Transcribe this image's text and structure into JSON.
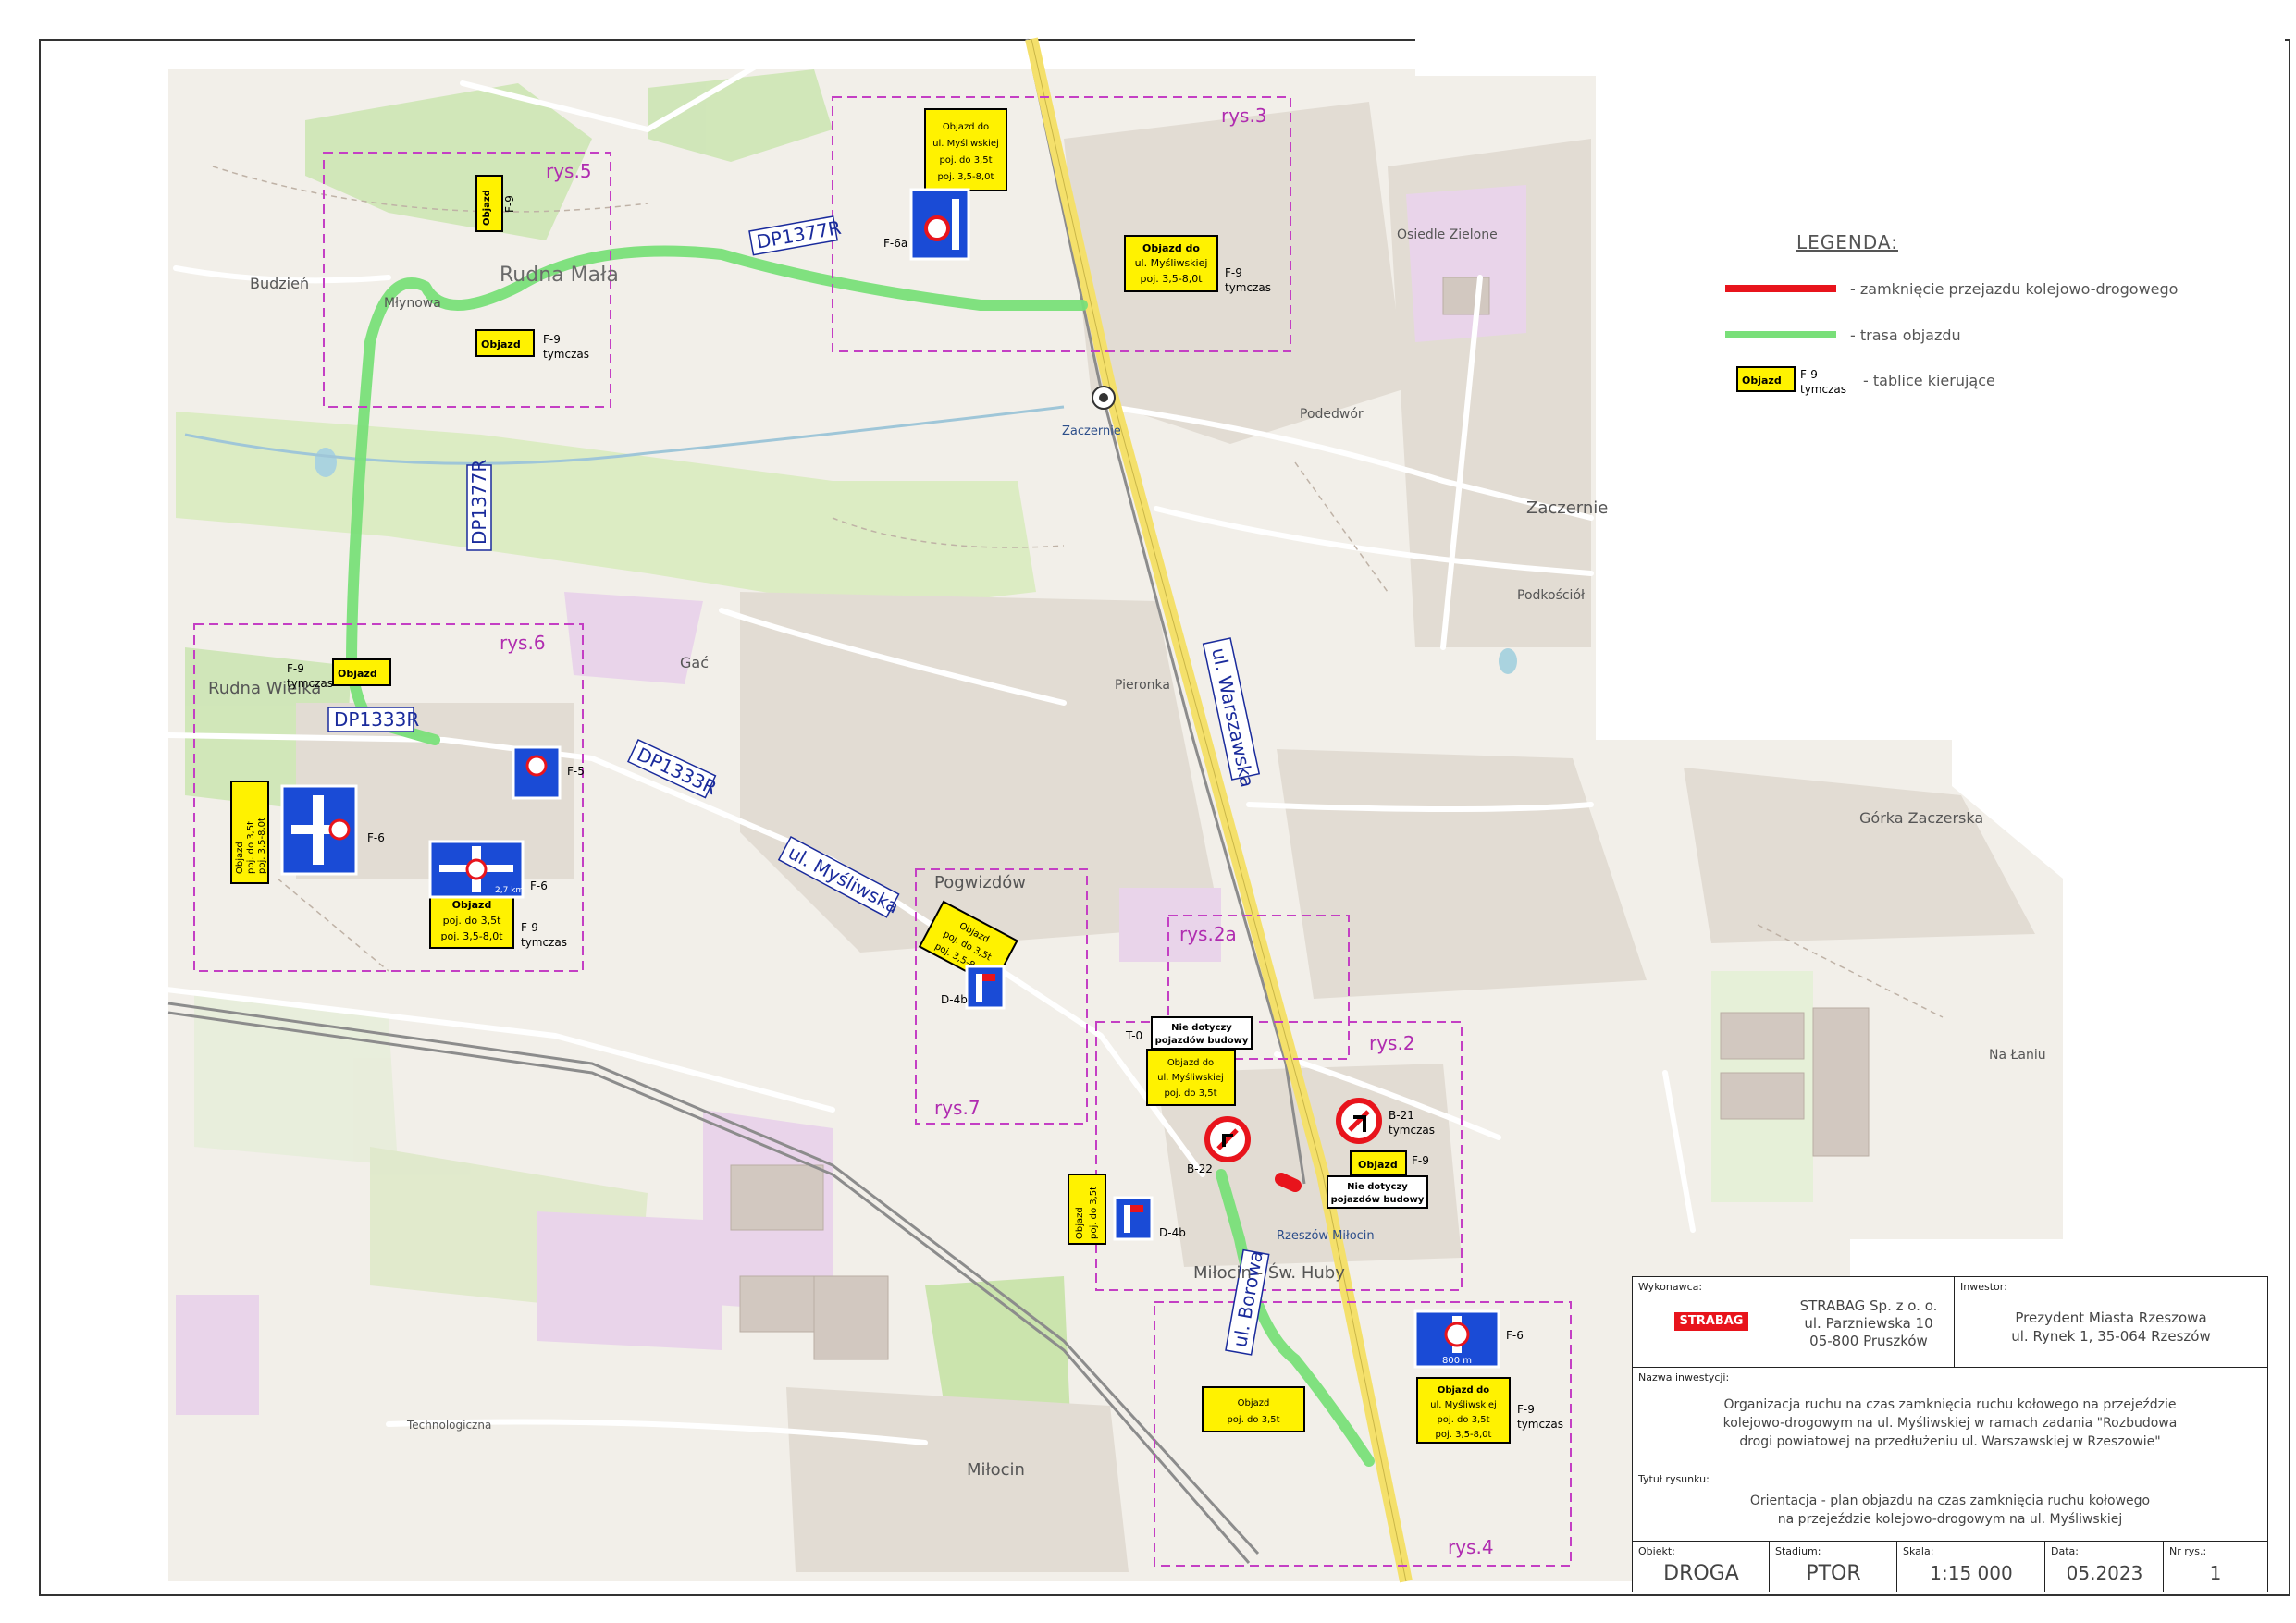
{
  "legend": {
    "title": "LEGENDA:",
    "closure": "- zamknięcie przejazdu kolejowo-drogowego",
    "detour": "- trasa objazdu",
    "sign_main": "Objazd",
    "sign_code": "F-9",
    "sign_temp": "tymczas",
    "signs": "- tablice kierujące",
    "colors": {
      "closure": "#e8141c",
      "detour": "#7fe07f",
      "sign": "#fff200",
      "frame": "#c43fc4"
    }
  },
  "frames": [
    {
      "label": "rys.5"
    },
    {
      "label": "rys.3"
    },
    {
      "label": "rys.6"
    },
    {
      "label": "rys.7"
    },
    {
      "label": "rys.2a"
    },
    {
      "label": "rys.2"
    },
    {
      "label": "rys.4"
    }
  ],
  "roads": {
    "dp1377r_a": "DP1377R",
    "dp1377r_b": "DP1377R",
    "dp1333r_a": "DP1333R",
    "dp1333r_b": "DP1333R",
    "mysliwska": "ul. Myśliwska",
    "warszawska": "ul. Warszawska",
    "borowa": "ul. Borowa"
  },
  "places": {
    "budzien": "Budzień",
    "rudna_mala": "Rudna Mała",
    "mlynowa": "Młynowa",
    "zaczernie": "Zaczernie",
    "zaczernie2": "Zaczernie",
    "podedwor": "Podedwór",
    "osiedle": "Osiedle Zielone",
    "podkosciol": "Podkościół",
    "rudna_wielka": "Rudna Wielka",
    "gac": "Gać",
    "pogwizdow": "Pogwizdów",
    "pieronka": "Pieronka",
    "gorka": "Górka Zaczerska",
    "na_laniu": "Na Łaniu",
    "rzeszow_milocin": "Rzeszów Miłocin",
    "milocin_sw": "Miłocin - Św. Huby",
    "milocin": "Miłocin",
    "technologiczna": "Technologiczna"
  },
  "signs": {
    "objazd": "Objazd",
    "f9": "F-9",
    "f6": "F-6",
    "f6a": "F-6a",
    "f5": "F-5",
    "d4b": "D-4b",
    "b21": "B-21",
    "b22": "B-22",
    "t0": "T-0",
    "tymczas": "tymczas",
    "objazd_do": "Objazd do",
    "ul_mysliwskiej": "ul. Myśliwskiej",
    "poj_35": "poj. do 3,5t",
    "poj_358": "poj. 3,5-8,0t",
    "nie_dotyczy": "Nie dotyczy",
    "pojazdow_budowy": "pojazdów budowy",
    "dist_27": "2,7 km",
    "dist_800": "800 m"
  },
  "title_block": {
    "contractor_label": "Wykonawca:",
    "contractor_logo": "STRABAG",
    "contractor_lines": [
      "STRABAG Sp. z o. o.",
      "ul. Parzniewska 10",
      "05-800 Pruszków"
    ],
    "investor_label": "Inwestor:",
    "investor_lines": [
      "Prezydent Miasta Rzeszowa",
      "ul. Rynek 1, 35-064 Rzeszów"
    ],
    "investment_label": "Nazwa inwestycji:",
    "investment_lines": [
      "Organizacja ruchu na czas zamknięcia ruchu kołowego na przejeździe",
      "kolejowo-drogowym na ul. Myśliwskiej w ramach zadania \"Rozbudowa",
      "drogi powiatowej na przedłużeniu ul. Warszawskiej w Rzeszowie\""
    ],
    "drawing_label": "Tytuł rysunku:",
    "drawing_lines": [
      "Orientacja - plan objazdu na czas zamknięcia ruchu kołowego",
      "na przejeździe kolejowo-drogowym na ul. Myśliwskiej"
    ],
    "object_label": "Obiekt:",
    "object": "DROGA",
    "stage_label": "Stadium:",
    "stage": "PTOR",
    "scale_label": "Skala:",
    "scale": "1:15 000",
    "date_label": "Data:",
    "date": "05.2023",
    "no_label": "Nr rys.:",
    "no": "1"
  }
}
